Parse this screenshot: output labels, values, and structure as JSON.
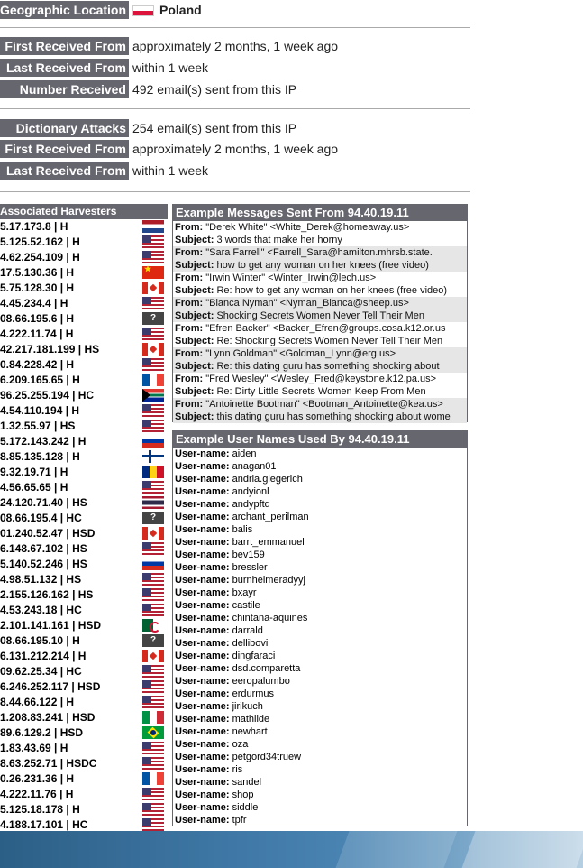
{
  "geo": {
    "label": "Geographic Location",
    "country": "Poland"
  },
  "received": {
    "first_label": "First Received From",
    "first_value": "approximately 2 months, 1 week ago",
    "last_label": "Last Received From",
    "last_value": "within 1 week",
    "number_label": "Number Received",
    "number_value": "492 email(s) sent from this IP"
  },
  "dictionary": {
    "label": "Dictionary Attacks",
    "value": "254 email(s) sent from this IP",
    "first_label": "First Received From",
    "first_value": "approximately 2 months, 1 week ago",
    "last_label": "Last Received From",
    "last_value": "within 1 week"
  },
  "harvesters": {
    "title": "Associated Harvesters",
    "rows": [
      {
        "ip": "5.17.173.8 | H",
        "flag": "nl"
      },
      {
        "ip": "5.125.52.162 | H",
        "flag": "us"
      },
      {
        "ip": "4.62.254.109 | H",
        "flag": "us"
      },
      {
        "ip": "17.5.130.36 | H",
        "flag": "cn"
      },
      {
        "ip": "5.75.128.30 | H",
        "flag": "ca"
      },
      {
        "ip": "4.45.234.4 | H",
        "flag": "us"
      },
      {
        "ip": "08.66.195.6 | H",
        "flag": "unknown"
      },
      {
        "ip": "4.222.11.74 | H",
        "flag": "us"
      },
      {
        "ip": "42.217.181.199 | HS",
        "flag": "ca"
      },
      {
        "ip": "0.84.228.42 | H",
        "flag": "us"
      },
      {
        "ip": "6.209.165.65 | H",
        "flag": "fr"
      },
      {
        "ip": "96.25.255.194 | HC",
        "flag": "za"
      },
      {
        "ip": "4.54.110.194 | H",
        "flag": "us"
      },
      {
        "ip": "1.32.55.97 | HS",
        "flag": "us"
      },
      {
        "ip": "5.172.143.242 | H",
        "flag": "ru"
      },
      {
        "ip": "8.85.135.128 | H",
        "flag": "fi"
      },
      {
        "ip": "9.32.19.71 | H",
        "flag": "ro"
      },
      {
        "ip": "4.56.65.65 | H",
        "flag": "us"
      },
      {
        "ip": "24.120.71.40 | HS",
        "flag": "th"
      },
      {
        "ip": "08.66.195.4 | HC",
        "flag": "unknown"
      },
      {
        "ip": "01.240.52.47 | HSD",
        "flag": "ca"
      },
      {
        "ip": "6.148.67.102 | HS",
        "flag": "us"
      },
      {
        "ip": "5.140.52.246 | HS",
        "flag": "ru"
      },
      {
        "ip": "4.98.51.132 | HS",
        "flag": "us"
      },
      {
        "ip": "2.155.126.162 | HS",
        "flag": "us"
      },
      {
        "ip": "4.53.243.18 | HC",
        "flag": "us"
      },
      {
        "ip": "2.101.141.161 | HSD",
        "flag": "dz"
      },
      {
        "ip": "08.66.195.10 | H",
        "flag": "unknown"
      },
      {
        "ip": "6.131.212.214 | H",
        "flag": "ca"
      },
      {
        "ip": "09.62.25.34 | HC",
        "flag": "us"
      },
      {
        "ip": "6.246.252.117 | HSD",
        "flag": "us"
      },
      {
        "ip": "8.44.66.122 | H",
        "flag": "us"
      },
      {
        "ip": "1.208.83.241 | HSD",
        "flag": "it"
      },
      {
        "ip": "89.6.129.2 | HSD",
        "flag": "br"
      },
      {
        "ip": "1.83.43.69 | H",
        "flag": "us"
      },
      {
        "ip": "8.63.252.71 | HSDC",
        "flag": "us"
      },
      {
        "ip": "0.26.231.36 | H",
        "flag": "fr"
      },
      {
        "ip": "4.222.11.76 | H",
        "flag": "us"
      },
      {
        "ip": "5.125.18.178 | H",
        "flag": "us"
      },
      {
        "ip": "4.188.17.101 | HC",
        "flag": "us"
      }
    ]
  },
  "messages": {
    "title": "Example Messages Sent From 94.40.19.11",
    "from_key": "From:",
    "subject_key": "Subject:",
    "items": [
      {
        "from": "\"Derek White\" <White_Derek@homeaway.us>",
        "subject": "3 words that make her horny"
      },
      {
        "from": "\"Sara Farrell\" <Farrell_Sara@hamilton.mhrsb.state.",
        "subject": "how to get any woman on her knees (free video)"
      },
      {
        "from": "\"Irwin Winter\" <Winter_Irwin@lech.us>",
        "subject": "Re: how to get any woman on her knees (free video)"
      },
      {
        "from": "\"Blanca Nyman\" <Nyman_Blanca@sheep.us>",
        "subject": "Shocking Secrets Women Never Tell Their Men"
      },
      {
        "from": "\"Efren Backer\" <Backer_Efren@groups.cosa.k12.or.us",
        "subject": "Re: Shocking Secrets Women Never Tell Their Men"
      },
      {
        "from": "\"Lynn Goldman\" <Goldman_Lynn@erg.us>",
        "subject": "Re: this dating guru has something shocking about"
      },
      {
        "from": "\"Fred Wesley\" <Wesley_Fred@keystone.k12.pa.us>",
        "subject": "Re: Dirty Little Secrets Women Keep From Men"
      },
      {
        "from": "\"Antoinette Bootman\" <Bootman_Antoinette@kea.us>",
        "subject": "this dating guru has something shocking about wome"
      }
    ]
  },
  "usernames": {
    "title": "Example User Names Used By 94.40.19.11",
    "key": "User-name:",
    "items": [
      "aiden",
      "anagan01",
      "andria.giegerich",
      "andyionl",
      "andypftq",
      "archant_perilman",
      "balis",
      "barrt_emmanuel",
      "bev159",
      "bressler",
      "burnheimeradyyj",
      "bxayr",
      "castile",
      "chintana-aquines",
      "darrald",
      "dellibovi",
      "dingfaraci",
      "dsd.comparetta",
      "eeropalumbo",
      "erdurmus",
      "jirikuch",
      "mathilde",
      "newhart",
      "oza",
      "petgord34truew",
      "ris",
      "sandel",
      "shop",
      "siddle",
      "tpfr"
    ]
  }
}
